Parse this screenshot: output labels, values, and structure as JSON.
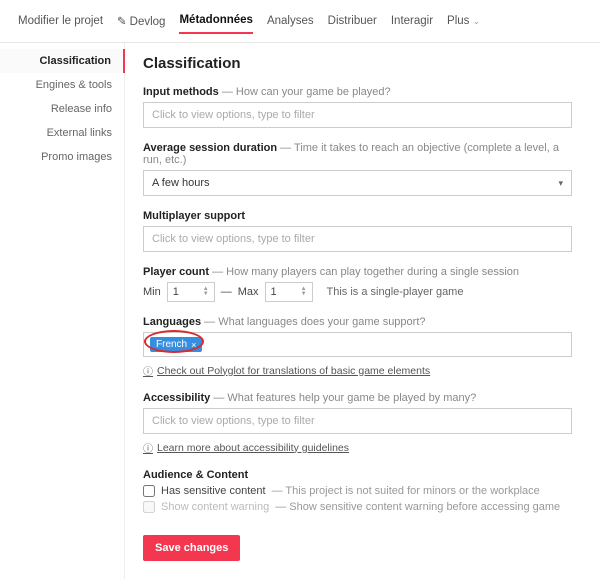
{
  "topnav": {
    "edit": "Modifier le projet",
    "devlog": "Devlog",
    "metadata": "Métadonnées",
    "analytics": "Analyses",
    "distribute": "Distribuer",
    "interact": "Interagir",
    "more": "Plus"
  },
  "sidebar": {
    "classification": "Classification",
    "engines": "Engines & tools",
    "release": "Release info",
    "external": "External links",
    "promo": "Promo images"
  },
  "page": {
    "title": "Classification"
  },
  "input_methods": {
    "label": "Input methods",
    "hint": "How can your game be played?",
    "placeholder": "Click to view options, type to filter"
  },
  "session": {
    "label": "Average session duration",
    "hint": "Time it takes to reach an objective (complete a level, a run, etc.)",
    "value": "A few hours"
  },
  "multiplayer": {
    "label": "Multiplayer support",
    "placeholder": "Click to view options, type to filter"
  },
  "players": {
    "label": "Player count",
    "hint": "How many players can play together during a single session",
    "min_label": "Min",
    "min": "1",
    "dash": "—",
    "max_label": "Max",
    "max": "1",
    "note": "This is a single-player game"
  },
  "languages": {
    "label": "Languages",
    "hint": "What languages does your game support?",
    "tag": "French",
    "polyglot": "Check out Polyglot for translations of basic game elements"
  },
  "accessibility": {
    "label": "Accessibility",
    "hint": "What features help your game be played by many?",
    "placeholder": "Click to view options, type to filter",
    "guidelines": "Learn more about accessibility guidelines"
  },
  "audience": {
    "label": "Audience & Content",
    "sensitive": "Has sensitive content",
    "sensitive_hint": "This project is not suited for minors or the workplace",
    "warning": "Show content warning",
    "warning_hint": "Show sensitive content warning before accessing game"
  },
  "save": "Save changes"
}
